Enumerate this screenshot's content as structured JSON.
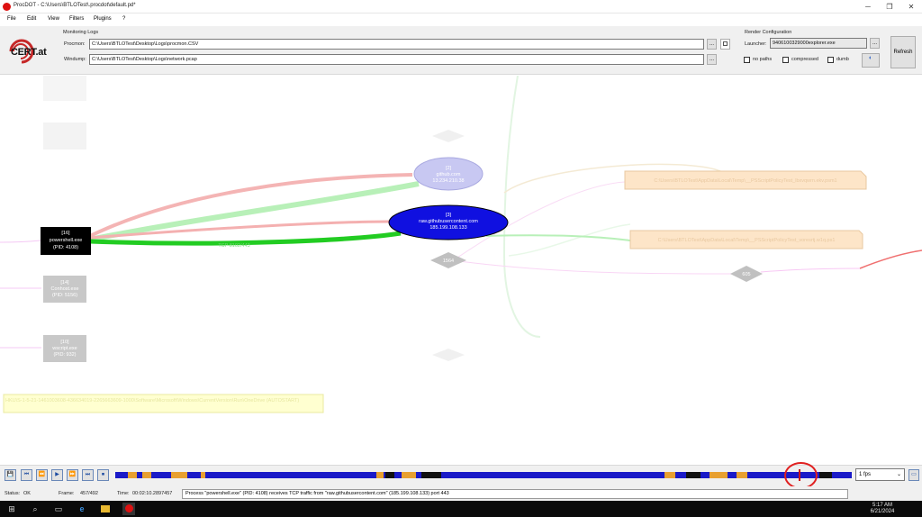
{
  "window": {
    "title": "ProcDOT - C:\\Users\\BTLOTest\\.procdot\\default.pd*",
    "minimize_glyph": "─",
    "maximize_glyph": "❐",
    "close_glyph": "✕"
  },
  "menu": [
    "File",
    "Edit",
    "View",
    "Filters",
    "Plugins",
    "?"
  ],
  "logo": {
    "text": "CERT.at"
  },
  "monitoring_logs": {
    "section_title": "Monitoring Logs",
    "procmon_label": "Procmon:",
    "procmon_value": "C:\\Users\\BTLOTest\\Desktop\\Logs\\procmon.CSV",
    "windump_label": "Windump:",
    "windump_value": "C:\\Users\\BTLOTest\\Desktop\\Logs\\network.pcap",
    "browse_label": "..."
  },
  "render_config": {
    "section_title": "Render Configuration",
    "launcher_label": "Launcher:",
    "launcher_value": "9406100329000explorer.exe",
    "browse_label": "...",
    "no_paths": "no paths",
    "compressed": "compressed",
    "dumb": "dumb",
    "refresh_label": "Refresh"
  },
  "graph": {
    "nodes": {
      "powershell": {
        "line1": "[16]",
        "line2": "powershell.exe",
        "line3": "(PID: 4108)"
      },
      "conhost": {
        "line1": "[14]",
        "line2": "Conhost.exe",
        "line3": "(PID: 5156)"
      },
      "wscript": {
        "line1": "[10]",
        "line2": "wscript.exe",
        "line3": "(PID: 932)"
      },
      "github": {
        "line1": "[2]",
        "line2": "github.com",
        "line3": "13.234.210.38"
      },
      "rawgithub": {
        "line1": "[3]",
        "line2": "raw.githubusercontent.com",
        "line3": "185.199.108.133"
      },
      "thread_1": "1564",
      "thread_2": "605",
      "file_1": "C:\\Users\\BTLOTest\\AppData\\Local\\Temp\\__PSScriptPolicyTest_lbxvqwrn.ekv.psm1",
      "file_2": "C:\\Users\\BTLOTest\\AppData\\Local\\Temp\\__PSScriptPolicyTest_voresrtj.w1q.ps1",
      "registry": "HKU\\S-1-5-21-1461003608-436634019-2265663609-1000\\Software\\Microsoft\\Windows\\CurrentVersion\\Run\\OneDrive (AUTOSTART)"
    },
    "edge_labels": {
      "tcp_in": "TCP 8102/443"
    }
  },
  "timeline": {
    "buttons": [
      "💾",
      "⏮",
      "⏪",
      "▶",
      "⏩",
      "⏭",
      "⏹"
    ],
    "fps": "1 fps",
    "fps_caret": "⌄"
  },
  "status": {
    "status_label": "Status:",
    "status_value": "OK",
    "frame_label": "Frame:",
    "frame_value": "457/492",
    "time_label": "Time:",
    "time_value": "00:02:10.2897457",
    "message": "Process \"powershell.exe\" (PID: 4108) receives TCP traffic from \"raw.githubusercontent.com\" (185.199.108.133) port 443"
  },
  "taskbar": {
    "start_glyph": "⊞",
    "search_glyph": "⌕",
    "taskview_glyph": "▭",
    "clock_time": "5:17 AM",
    "clock_date": "6/21/2024"
  },
  "colors": {
    "process_active": "#000000",
    "process_inactive": "#c8c8c8",
    "server_active": "#1010e0",
    "server_inactive": "#c8c8f0",
    "edge_green": "#22cc22",
    "edge_red": "#f0a0a0",
    "annotation_red": "#e02020"
  }
}
